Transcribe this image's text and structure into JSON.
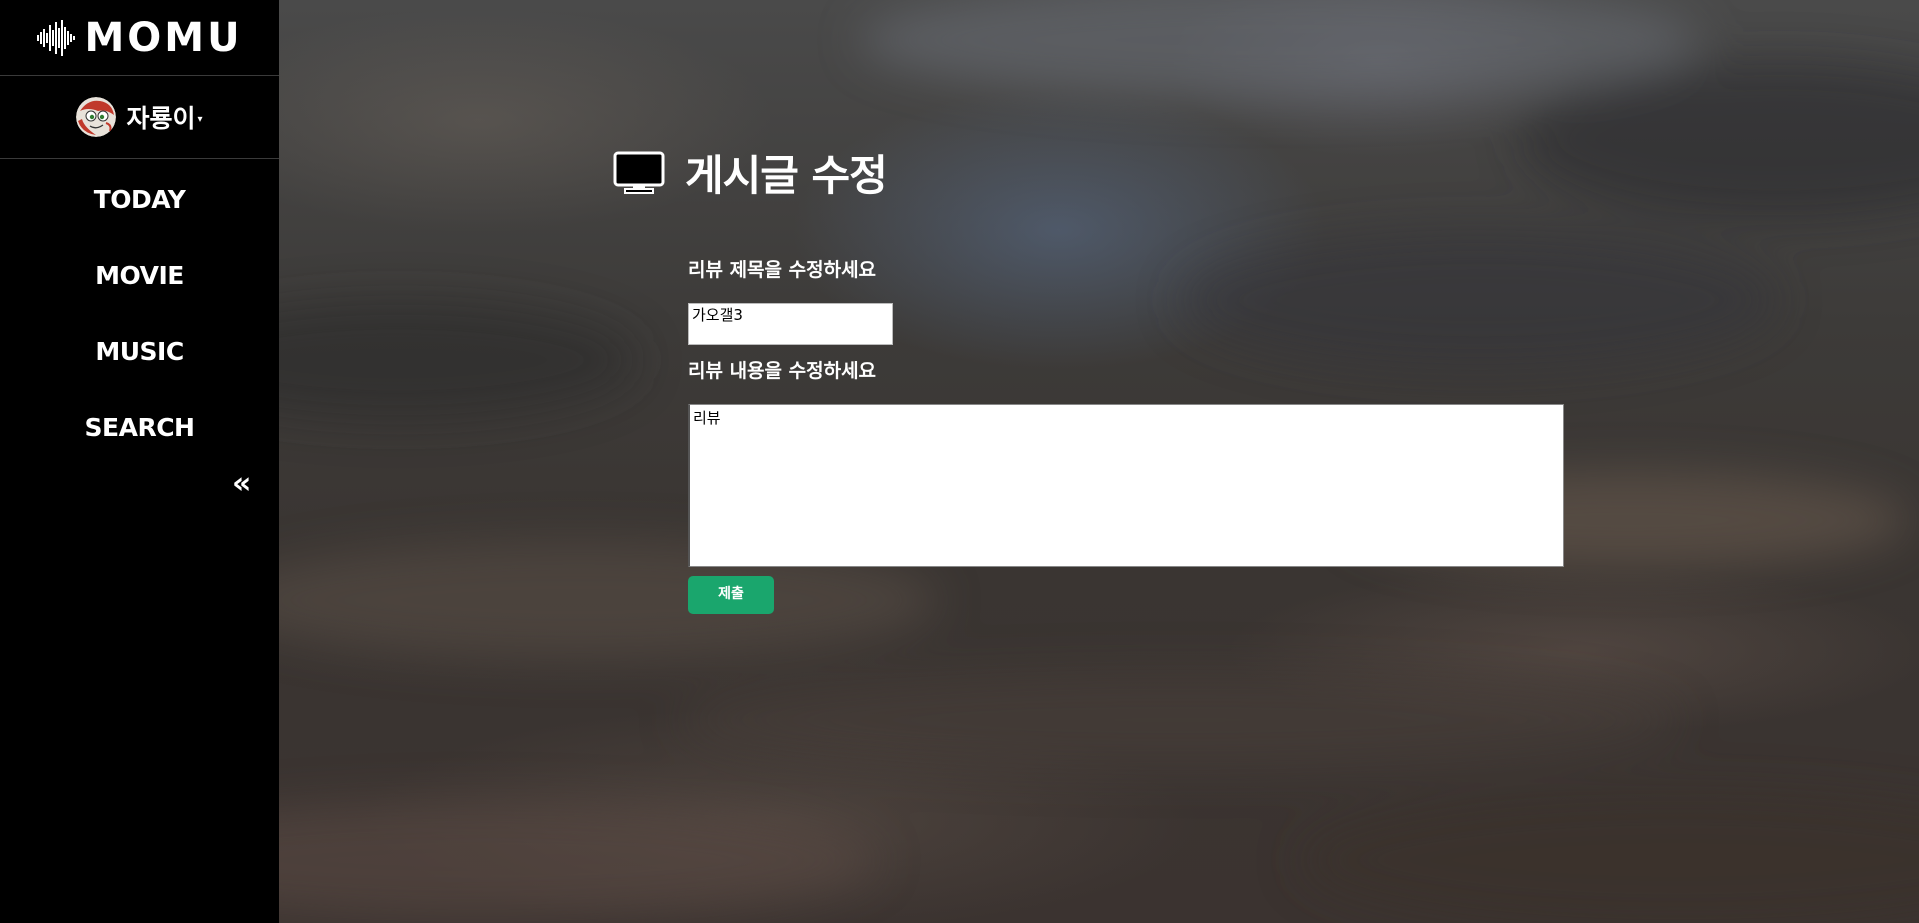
{
  "brand": {
    "name": "MOMU"
  },
  "user": {
    "name": "자룡이",
    "dropdown_caret": "▾"
  },
  "nav": {
    "items": [
      {
        "label": "TODAY"
      },
      {
        "label": "MOVIE"
      },
      {
        "label": "MUSIC"
      },
      {
        "label": "SEARCH"
      }
    ],
    "collapse_label": "«"
  },
  "page": {
    "title": "게시글 수정",
    "title_icon": "monitor-icon"
  },
  "form": {
    "title_label": "리뷰 제목을 수정하세요",
    "title_value": "가오갤3",
    "content_label": "리뷰 내용을 수정하세요",
    "content_value": "리뷰",
    "submit_label": "제출"
  },
  "colors": {
    "sidebar_bg": "#000000",
    "submit_bg": "#1aa66d",
    "text": "#ffffff"
  }
}
